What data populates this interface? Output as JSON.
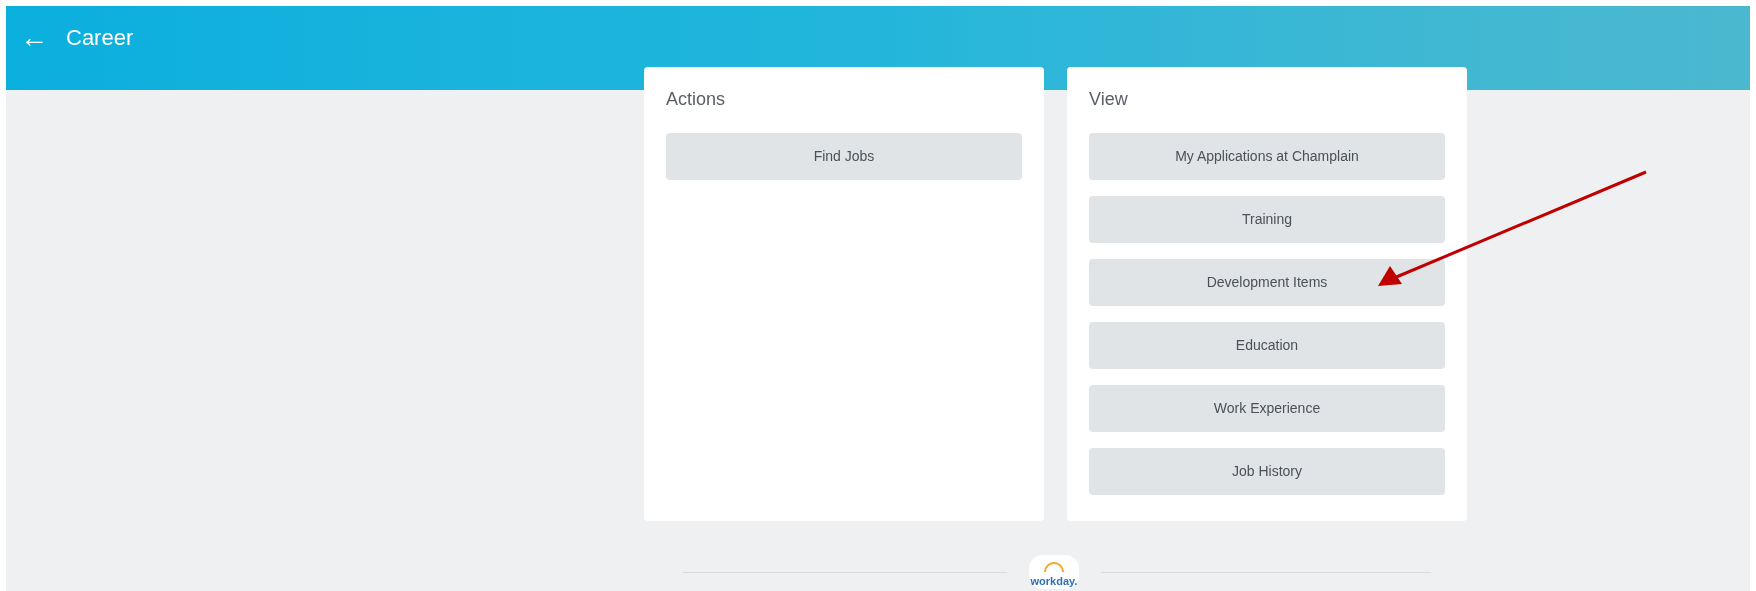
{
  "header": {
    "back_icon": "←",
    "title": "Career"
  },
  "actions": {
    "title": "Actions",
    "buttons": [
      "Find Jobs"
    ]
  },
  "view": {
    "title": "View",
    "buttons": [
      "My Applications at Champlain",
      "Training",
      "Development Items",
      "Education",
      "Work Experience",
      "Job History"
    ]
  },
  "footer": {
    "logo_text": "workday."
  }
}
